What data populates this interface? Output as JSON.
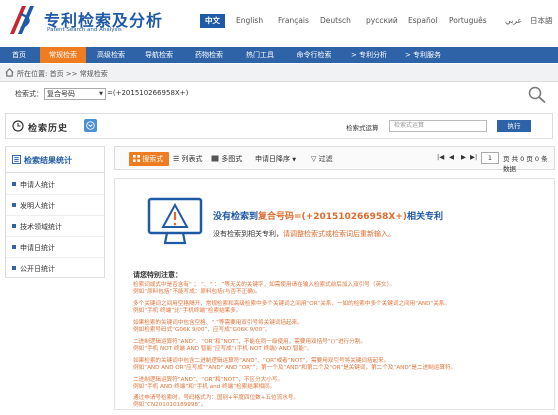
{
  "header": {
    "title": "专利检索及分析",
    "subtitle": "Patent Search and Analysis",
    "languages": [
      "中文",
      "English",
      "Français",
      "Deutsch",
      "русский",
      "Español",
      "Português",
      "عربي",
      "日本語"
    ]
  },
  "nav": {
    "items": [
      "首页",
      "常规检索",
      "高级检索",
      "导航检索",
      "药物检索",
      "热门工具",
      "命令行检索",
      "> 专利分析",
      "> 专利服务"
    ]
  },
  "breadcrumb": {
    "text": "所在位置: 首页 >> 常规检索"
  },
  "search": {
    "label": "检索式：",
    "select_value": "复合号码",
    "query": "=(+201510266958X+)"
  },
  "history": {
    "title": "检索历史",
    "calc_label": "检索式运算",
    "calc_placeholder": "检索式运算",
    "exec_label": "执行"
  },
  "sidebar": {
    "title": "检索结果统计",
    "items": [
      "申请人统计",
      "发明人统计",
      "技术领域统计",
      "申请日统计",
      "公开日统计"
    ]
  },
  "toolbar": {
    "views": [
      "搜索式",
      "列表式",
      "多图式"
    ],
    "sort": "申请日降序",
    "filter": "过滤",
    "page_value": "1",
    "page_info": "页 共 0 页  0 条数据"
  },
  "result": {
    "title_prefix": "没有检索到",
    "title_highlight": "复合号码=(+201510266958X+)",
    "title_suffix": "相关专利",
    "sub_prefix": "没有检索到相关专利，",
    "sub_highlight": "请调整检索式或检索词后重新输入。",
    "tips_title": "请您特别注意：",
    "tips": [
      "检索词或式中是否含有“ ； ”、“ ： ”等无关的关键字，如需使用请在输入检索式前后加入双引号（英文）。",
      "例如“原料包括”不能写成：原料包括(与否不正确)。",
      "多个关键词之间用空格隔开，常规检索和高级检索中多个关键词之间用“OR”关系，一如的检索中多个关键词之间用“AND”关系。",
      "例如“手机 终端”比“手机终端”检索结果多。",
      "如果检索的关键词中包含空格、“ ”等需要用双引号将关键词括起来。",
      "例如检索号码式“G06K 9/00”，应写成“G06K 9/00”。",
      "二进制逻辑运算符“AND”、“OR”和“NOT”，不能在同一级使用，需要用双括号“()”进行分割。",
      "例如“手机 NOT 终端 AND 智能”应写成“(手机 NOT 终端) AND 智能”。",
      "如果检索的关键词中包含二进制逻辑运算符“AND”、“OR”或者“NOT”，需要用双引号将关键词括起来。",
      "例如“AND AND OR”应写成“\"AND\" AND \"OR\"”，第一个及“AND”和第二个及“OR”是关键词，第二个及“AND”是二进制运算符。",
      "二进制逻辑运算符“AND”、“OR”和“NOT”，不区分大小写。",
      "例如“手机 AND 终端”和“手机 and 终端”检索结果相同。",
      "通过申请号检索时，号码格式为：国别+年度四位数+五位流水号。",
      "例如“CN201010189998”。"
    ]
  }
}
